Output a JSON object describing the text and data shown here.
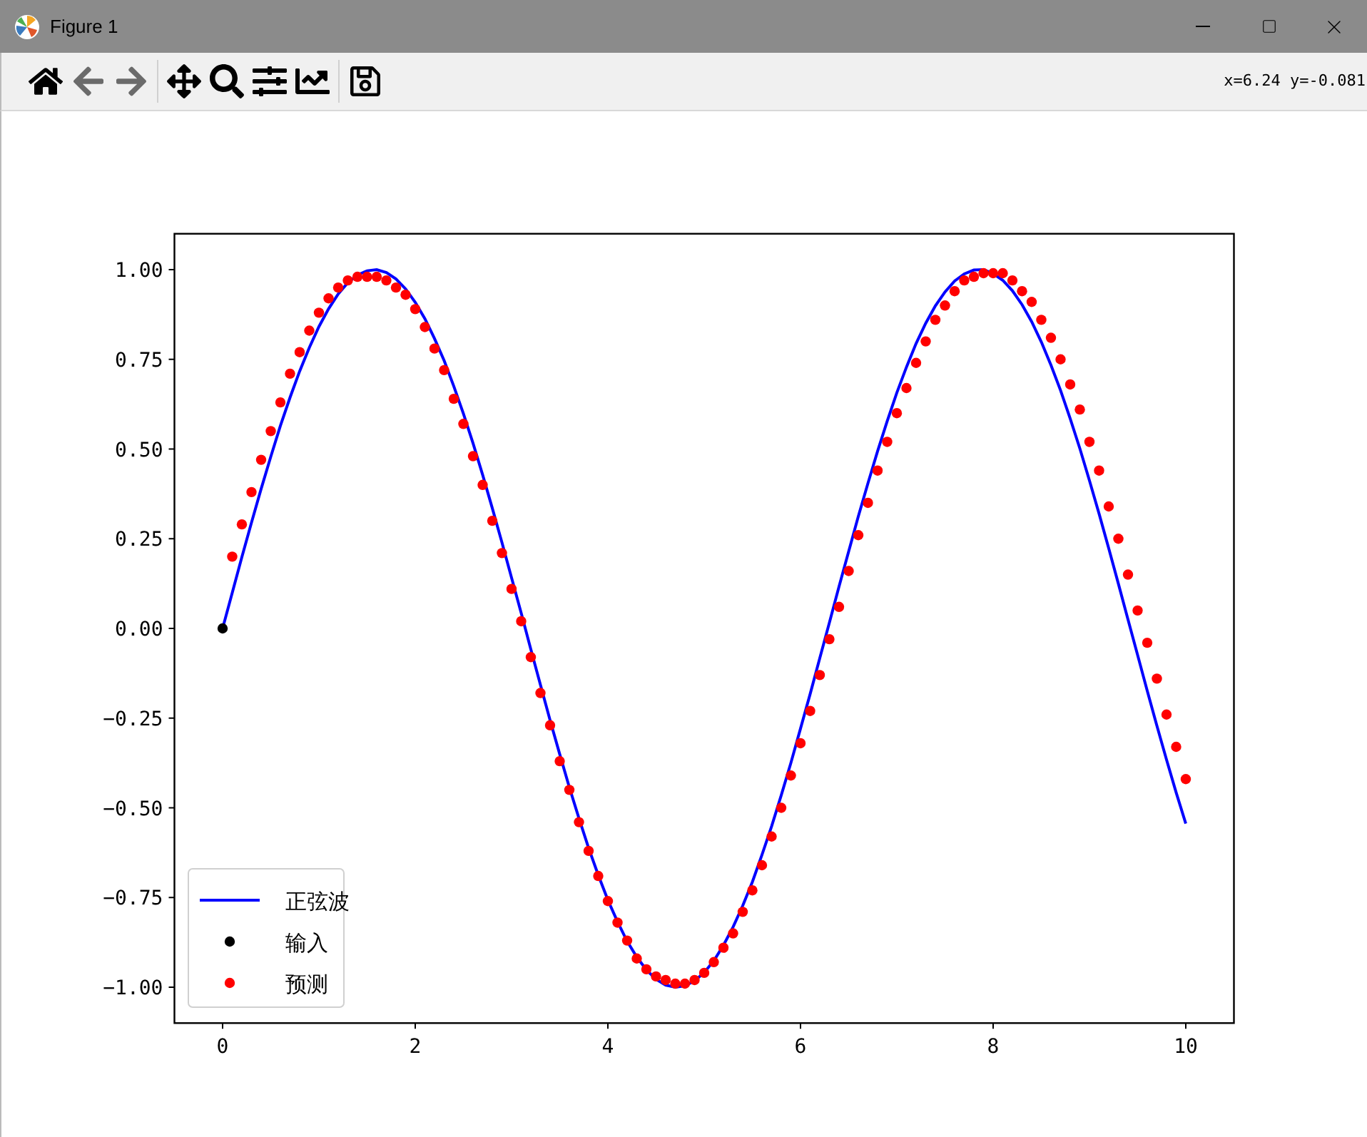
{
  "window": {
    "title": "Figure 1"
  },
  "toolbar": {
    "tools": [
      {
        "kind": "home",
        "disabled": false
      },
      {
        "kind": "back",
        "disabled": true
      },
      {
        "kind": "forward",
        "disabled": true
      },
      {
        "kind": "pan",
        "disabled": false
      },
      {
        "kind": "zoom",
        "disabled": false
      },
      {
        "kind": "subplots",
        "disabled": false
      },
      {
        "kind": "customize",
        "disabled": false
      },
      {
        "kind": "save",
        "disabled": false
      }
    ],
    "coordinates": "x=6.24 y=-0.081"
  },
  "figure": {
    "chart_data": {
      "type": "line",
      "legend": "lower left",
      "xlim": [
        -0.5,
        10.5
      ],
      "ylim": [
        -1.1,
        1.1
      ],
      "xticks": [
        0,
        2,
        4,
        6,
        8,
        10
      ],
      "yticks": [
        {
          "value": 1,
          "label": "1.00"
        },
        {
          "value": 0.75,
          "label": "0.75"
        },
        {
          "value": 0.5,
          "label": "0.50"
        },
        {
          "value": 0.25,
          "label": "0.25"
        },
        {
          "value": 0,
          "label": "0.00"
        },
        {
          "value": -0.25,
          "label": "−0.25"
        },
        {
          "value": -0.5,
          "label": "−0.50"
        },
        {
          "value": -0.75,
          "label": "−0.75"
        },
        {
          "value": -1,
          "label": "−1.00"
        }
      ],
      "x": [
        0,
        0.1,
        0.2,
        0.3,
        0.4,
        0.5,
        0.6,
        0.7,
        0.8,
        0.9,
        1,
        1.1,
        1.2,
        1.3,
        1.4,
        1.5,
        1.6,
        1.7,
        1.8,
        1.9,
        2,
        2.1,
        2.2,
        2.3,
        2.4,
        2.5,
        2.6,
        2.7,
        2.8,
        2.9,
        3,
        3.1,
        3.2,
        3.3,
        3.4,
        3.5,
        3.6,
        3.7,
        3.8,
        3.9,
        4,
        4.1,
        4.2,
        4.3,
        4.4,
        4.5,
        4.6,
        4.7,
        4.8,
        4.9,
        5,
        5.1,
        5.2,
        5.3,
        5.4,
        5.5,
        5.6,
        5.7,
        5.8,
        5.9,
        6,
        6.1,
        6.2,
        6.3,
        6.4,
        6.5,
        6.6,
        6.7,
        6.8,
        6.9,
        7,
        7.1,
        7.2,
        7.3,
        7.4,
        7.5,
        7.6,
        7.7,
        7.8,
        7.9,
        8,
        8.1,
        8.2,
        8.3,
        8.4,
        8.5,
        8.6,
        8.7,
        8.8,
        8.9,
        9,
        9.1,
        9.2,
        9.3,
        9.4,
        9.5,
        9.6,
        9.7,
        9.8,
        9.9,
        10
      ],
      "series": [
        {
          "name": "正弦波",
          "type": "line",
          "color": "#0000ff",
          "values": [
            0,
            0.1,
            0.199,
            0.296,
            0.389,
            0.479,
            0.565,
            0.644,
            0.717,
            0.783,
            0.841,
            0.891,
            0.932,
            0.964,
            0.985,
            0.997,
            1,
            0.992,
            0.974,
            0.946,
            0.909,
            0.863,
            0.808,
            0.746,
            0.675,
            0.598,
            0.516,
            0.427,
            0.335,
            0.239,
            0.141,
            0.042,
            -0.058,
            -0.158,
            -0.256,
            -0.351,
            -0.443,
            -0.53,
            -0.612,
            -0.688,
            -0.757,
            -0.818,
            -0.872,
            -0.916,
            -0.952,
            -0.978,
            -0.994,
            -1,
            -0.996,
            -0.982,
            -0.959,
            -0.926,
            -0.883,
            -0.832,
            -0.773,
            -0.706,
            -0.631,
            -0.551,
            -0.465,
            -0.374,
            -0.279,
            -0.182,
            -0.083,
            0.017,
            0.117,
            0.215,
            0.312,
            0.405,
            0.494,
            0.578,
            0.657,
            0.729,
            0.794,
            0.851,
            0.899,
            0.938,
            0.968,
            0.988,
            0.999,
            1,
            0.989,
            0.97,
            0.941,
            0.902,
            0.855,
            0.798,
            0.734,
            0.663,
            0.585,
            0.501,
            0.412,
            0.319,
            0.223,
            0.124,
            0.025,
            -0.075,
            -0.174,
            -0.272,
            -0.366,
            -0.458,
            -0.544
          ]
        },
        {
          "name": "输入",
          "type": "scatter",
          "marker": "circle",
          "color": "#000000",
          "values": [
            0,
            null,
            null,
            null,
            null,
            null,
            null,
            null,
            null,
            null,
            null,
            null,
            null,
            null,
            null,
            null,
            null,
            null,
            null,
            null,
            null,
            null,
            null,
            null,
            null,
            null,
            null,
            null,
            null,
            null,
            null,
            null,
            null,
            null,
            null,
            null,
            null,
            null,
            null,
            null,
            null,
            null,
            null,
            null,
            null,
            null,
            null,
            null,
            null,
            null,
            null,
            null,
            null,
            null,
            null,
            null,
            null,
            null,
            null,
            null,
            null,
            null,
            null,
            null,
            null,
            null,
            null,
            null,
            null,
            null,
            null,
            null,
            null,
            null,
            null,
            null,
            null,
            null,
            null,
            null,
            null,
            null,
            null,
            null,
            null,
            null,
            null,
            null,
            null,
            null,
            null,
            null,
            null,
            null,
            null,
            null,
            null,
            null,
            null,
            null,
            null
          ]
        },
        {
          "name": "预测",
          "type": "scatter",
          "marker": "circle",
          "color": "#ff0000",
          "values": [
            null,
            0.2,
            0.29,
            0.38,
            0.47,
            0.55,
            0.63,
            0.71,
            0.77,
            0.83,
            0.88,
            0.92,
            0.95,
            0.97,
            0.98,
            0.98,
            0.98,
            0.97,
            0.95,
            0.93,
            0.89,
            0.84,
            0.78,
            0.72,
            0.64,
            0.57,
            0.48,
            0.4,
            0.3,
            0.21,
            0.11,
            0.02,
            -0.08,
            -0.18,
            -0.27,
            -0.37,
            -0.45,
            -0.54,
            -0.62,
            -0.69,
            -0.76,
            -0.82,
            -0.87,
            -0.92,
            -0.95,
            -0.97,
            -0.98,
            -0.99,
            -0.99,
            -0.98,
            -0.96,
            -0.93,
            -0.89,
            -0.85,
            -0.79,
            -0.73,
            -0.66,
            -0.58,
            -0.5,
            -0.41,
            -0.32,
            -0.23,
            -0.13,
            -0.03,
            0.06,
            0.16,
            0.26,
            0.35,
            0.44,
            0.52,
            0.6,
            0.67,
            0.74,
            0.8,
            0.86,
            0.9,
            0.94,
            0.97,
            0.98,
            0.99,
            0.99,
            0.99,
            0.97,
            0.94,
            0.91,
            0.86,
            0.81,
            0.75,
            0.68,
            0.61,
            0.52,
            0.44,
            0.34,
            0.25,
            0.15,
            0.05,
            -0.04,
            -0.14,
            -0.24,
            -0.33,
            -0.42
          ]
        }
      ]
    }
  }
}
